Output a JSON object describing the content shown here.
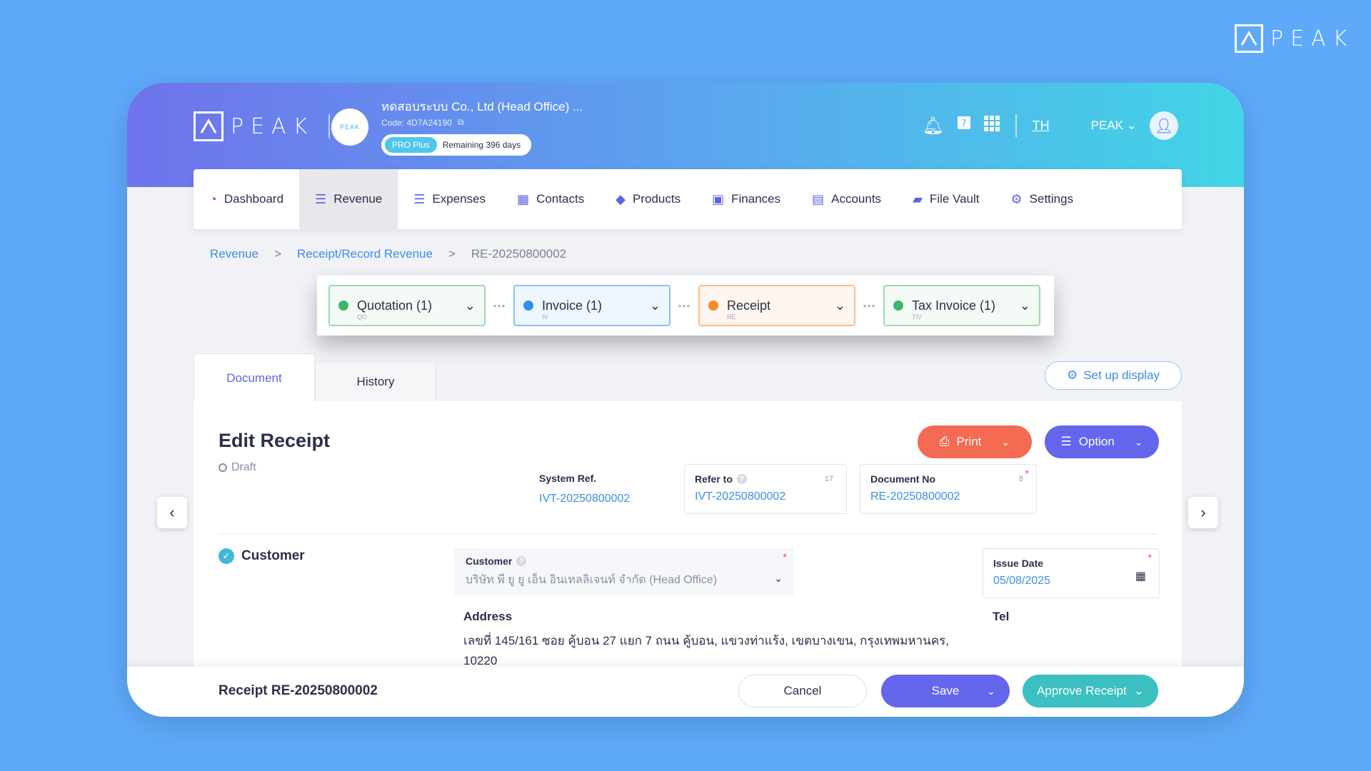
{
  "brand": {
    "name": "PEAK"
  },
  "header": {
    "company_name": "ทดสอบระบบ Co., Ltd (Head Office) ...",
    "company_code": "Code: 4D7A24190",
    "company_logo_text": "PEAK",
    "plan": "PRO Plus",
    "remaining": "Remaining 396 days",
    "lang": "TH",
    "user": "PEAK"
  },
  "nav": [
    {
      "label": "Dashboard",
      "icon": "dashboard-icon"
    },
    {
      "label": "Revenue",
      "icon": "revenue-icon",
      "active": true
    },
    {
      "label": "Expenses",
      "icon": "expenses-icon"
    },
    {
      "label": "Contacts",
      "icon": "contacts-icon"
    },
    {
      "label": "Products",
      "icon": "products-icon"
    },
    {
      "label": "Finances",
      "icon": "finances-icon"
    },
    {
      "label": "Accounts",
      "icon": "accounts-icon"
    },
    {
      "label": "File Vault",
      "icon": "folder-icon"
    },
    {
      "label": "Settings",
      "icon": "gear-icon"
    }
  ],
  "breadcrumb": {
    "root": "Revenue",
    "section": "Receipt/Record Revenue",
    "current": "RE-20250800002",
    "sep": ">"
  },
  "flow": [
    {
      "label": "Quotation (1)",
      "code": "QO",
      "color": "#3cb56b"
    },
    {
      "label": "Invoice (1)",
      "code": "IV",
      "color": "#2f8ff0"
    },
    {
      "label": "Receipt",
      "code": "RE",
      "color": "#f7892d"
    },
    {
      "label": "Tax Invoice (1)",
      "code": "TIV",
      "color": "#3cb56b"
    }
  ],
  "tabs": {
    "document": "Document",
    "history": "History"
  },
  "setup_display": "Set up display",
  "form": {
    "title": "Edit Receipt",
    "status": "Draft",
    "print_label": "Print",
    "option_label": "Option",
    "system_ref_label": "System Ref.",
    "system_ref_value": "IVT-20250800002",
    "refer_to_label": "Refer to",
    "refer_to_value": "IVT-20250800002",
    "refer_to_count": "17",
    "document_no_label": "Document No",
    "document_no_value": "RE-20250800002",
    "document_no_count": "8",
    "customer_section": "Customer",
    "customer_label": "Customer",
    "customer_value": "บริษัท พี ยู ยู เอ็น อินเทลลิเจนท์ จำกัด (Head Office)",
    "issue_date_label": "Issue Date",
    "issue_date_value": "05/08/2025",
    "address_label": "Address",
    "address_value": "เลขที่ 145/161 ซอย คู้บอน 27 แยก 7 ถนน คู้บอน, แขวงท่าแร้ง, เขตบางเขน, กรุงเทพมหานคร, 10220",
    "tel_label": "Tel"
  },
  "bottom": {
    "doc_title": "Receipt RE-20250800002",
    "cancel": "Cancel",
    "save": "Save",
    "approve": "Approve Receipt"
  }
}
